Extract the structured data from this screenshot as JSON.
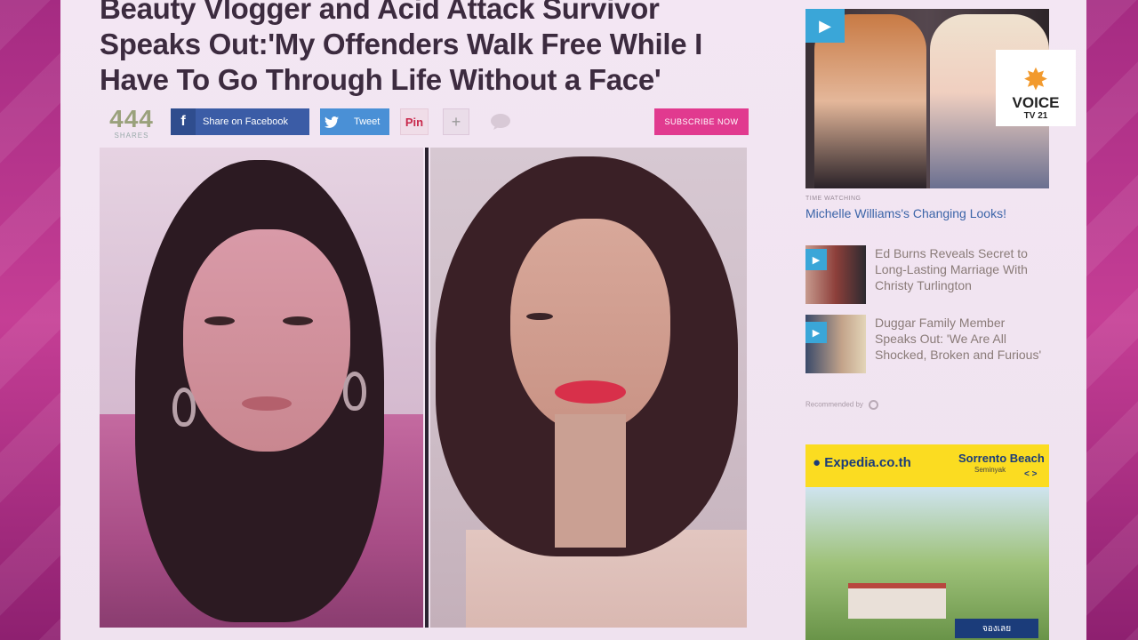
{
  "article": {
    "headline_line1": "Beauty Vlogger and Acid Attack Survivor",
    "headline_line2": "Speaks Out:'My Offenders Walk Free While I",
    "headline_line3": "Have To Go Through Life Without a Face'",
    "share_count": "444",
    "share_label": "SHARES",
    "facebook_label": "Share on Facebook",
    "tweet_label": "Tweet",
    "pin_label": "Pin",
    "more_label": "+",
    "subscribe_label": "SUBSCRIBE NOW"
  },
  "sidebar": {
    "hero_sponsor_label": "TIME WATCHING",
    "hero_title": "Michelle Williams's Changing Looks!",
    "voice_logo_word": "VOICE",
    "voice_logo_channel": "TV 21",
    "recommended": [
      {
        "title": "Ed Burns Reveals Secret to Long-Lasting Marriage With Christy Turlington"
      },
      {
        "title": "Duggar Family Member Speaks Out: 'We Are All Shocked, Broken and Furious'"
      }
    ],
    "recommended_by": "Recommended by"
  },
  "ad": {
    "brand": "Expedia.co.th",
    "destination": "Sorrento Beach",
    "destination_sub": "Seminyak",
    "nav": "< >",
    "cta": "จองเลย"
  },
  "colors": {
    "facebook": "#3b5ca6",
    "twitter": "#4a90d6",
    "subscribe": "#e13a8f",
    "link": "#3b64a8",
    "ad_bg": "#fbdc21"
  }
}
